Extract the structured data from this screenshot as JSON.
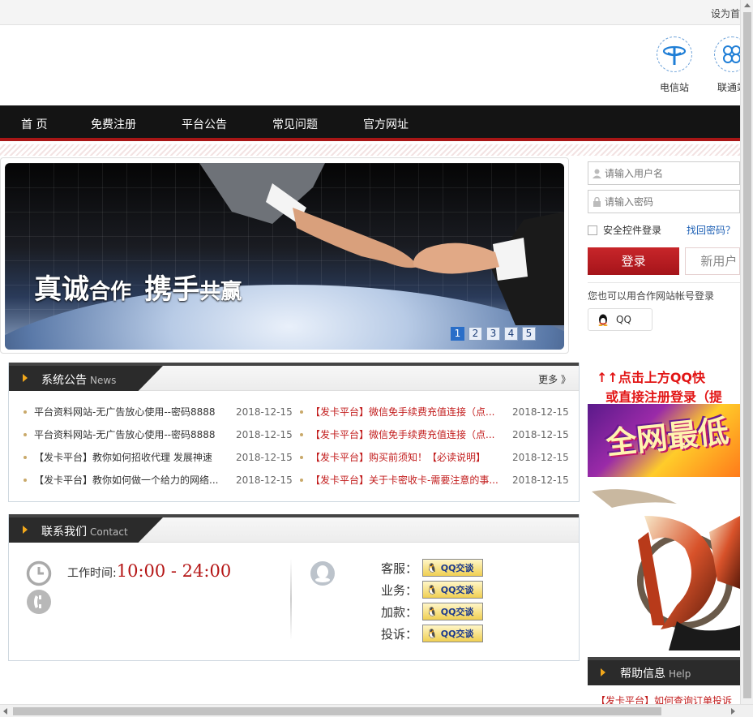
{
  "topbar": {
    "set_home": "设为首"
  },
  "stations": [
    {
      "label": "电信站"
    },
    {
      "label": "联通站"
    }
  ],
  "nav": [
    "首 页",
    "免费注册",
    "平台公告",
    "常见问题",
    "官方网址"
  ],
  "banner": {
    "slogan_a": "真诚",
    "slogan_b": "合作",
    "slogan_c": "携手",
    "slogan_d": "共赢",
    "pages": [
      "1",
      "2",
      "3",
      "4",
      "5"
    ],
    "active_page": "1"
  },
  "login": {
    "username_placeholder": "请输入用户名",
    "password_placeholder": "请输入密码",
    "secure_login": "安全控件登录",
    "forgot": "找回密码？",
    "login_button": "登录",
    "register_button": "新用户",
    "partner_text": "您也可以用合作网站帐号登录",
    "qq_login": "QQ"
  },
  "news": {
    "title": "系统公告",
    "title_en": "News",
    "more": "更多 》",
    "items_left": [
      {
        "title": "平台资料网站-无广告放心使用--密码8888",
        "date": "2018-12-15",
        "highlight": false
      },
      {
        "title": "平台资料网站-无广告放心使用--密码8888",
        "date": "2018-12-15",
        "highlight": false
      },
      {
        "title": "【发卡平台】教你如何招收代理 发展神速",
        "date": "2018-12-15",
        "highlight": false
      },
      {
        "title": "【发卡平台】教你如何做一个给力的网络...",
        "date": "2018-12-15",
        "highlight": false
      }
    ],
    "items_right": [
      {
        "title": "【发卡平台】微信免手续费充值连接（点...",
        "date": "2018-12-15",
        "highlight": true
      },
      {
        "title": "【发卡平台】微信免手续费充值连接（点...",
        "date": "2018-12-15",
        "highlight": true
      },
      {
        "title": "【发卡平台】购买前须知！【必读说明】",
        "date": "2018-12-15",
        "highlight": true
      },
      {
        "title": "【发卡平台】关于卡密收卡-需要注意的事...",
        "date": "2018-12-15",
        "highlight": true
      }
    ]
  },
  "contact": {
    "title": "联系我们",
    "title_en": "Contact",
    "work_label": "工作时间:",
    "work_hours": "10:00 - 24:00",
    "services": [
      {
        "label": "客服：",
        "badge": "QQ交谈"
      },
      {
        "label": "业务：",
        "badge": "QQ交谈"
      },
      {
        "label": "加款：",
        "badge": "QQ交谈"
      },
      {
        "label": "投诉：",
        "badge": "QQ交谈"
      }
    ]
  },
  "side": {
    "notice_line1": "↑↑点击上方QQ快",
    "notice_line2": "或直接注册登录（提",
    "ad_text": "全网最低"
  },
  "help": {
    "title": "帮助信息",
    "title_en": "Help",
    "first_item": "【发卡平台】如何查询订单投诉"
  }
}
